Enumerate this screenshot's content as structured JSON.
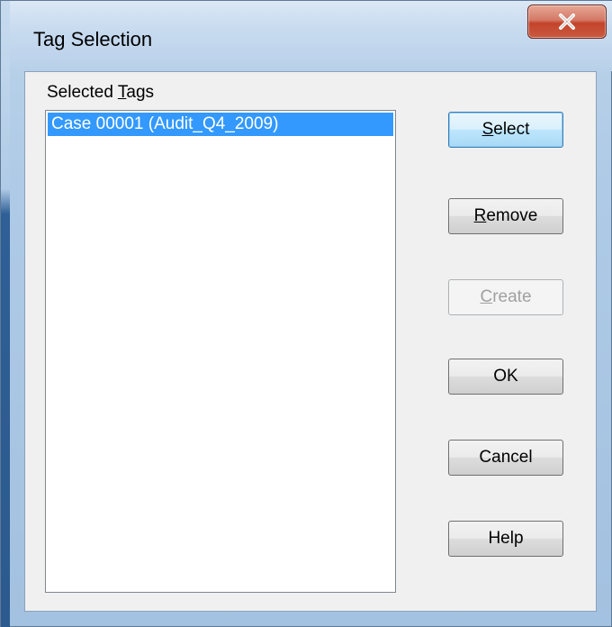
{
  "window": {
    "title": "Tag Selection"
  },
  "tags": {
    "label_before": "Selected ",
    "label_mnemonic": "T",
    "label_after": "ags",
    "items": [
      {
        "label": "Case 00001 (Audit_Q4_2009)",
        "selected": true
      }
    ]
  },
  "buttons": {
    "select": {
      "mnemonic": "S",
      "rest": "elect"
    },
    "remove": {
      "mnemonic": "R",
      "rest": "emove"
    },
    "create": {
      "mnemonic": "C",
      "rest": "reate",
      "enabled": false
    },
    "ok": {
      "label": "OK"
    },
    "cancel": {
      "label": "Cancel"
    },
    "help": {
      "label": "Help"
    }
  },
  "icons": {
    "close": "close-icon"
  },
  "colors": {
    "selection": "#3399ff",
    "close_button": "#c4442b",
    "dialog_face": "#f0f0f0"
  }
}
